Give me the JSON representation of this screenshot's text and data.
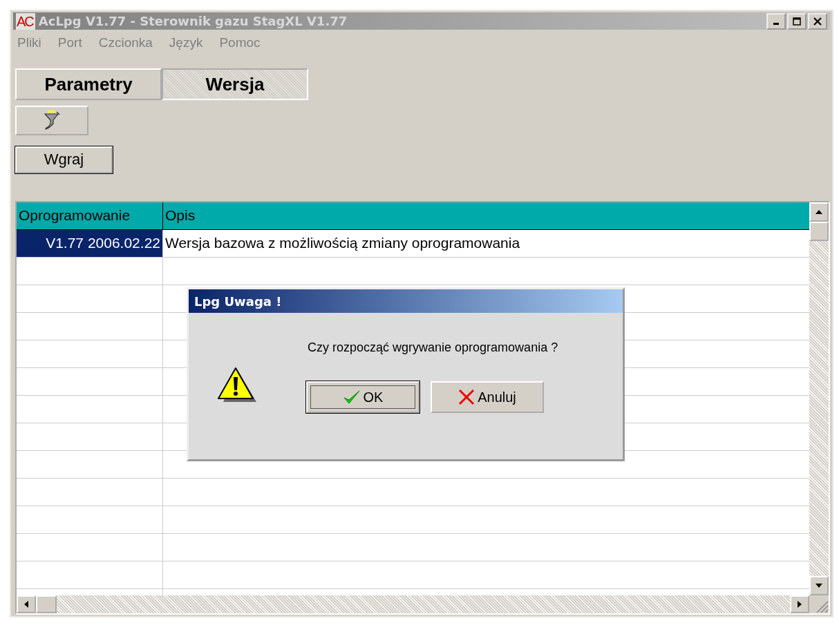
{
  "window": {
    "title": "AcLpg V1.77 - Sterownik gazu StagXL V1.77",
    "logo": "AC"
  },
  "menu": [
    "Pliki",
    "Port",
    "Czcionka",
    "Język",
    "Pomoc"
  ],
  "tabs": [
    {
      "label": "Parametry",
      "selected": false
    },
    {
      "label": "Wersja",
      "selected": true
    }
  ],
  "buttons": [
    {
      "kind": "icon"
    },
    {
      "kind": "text",
      "label": "Wgraj"
    }
  ],
  "table": {
    "columns": [
      "Oprogramowanie",
      "Opis"
    ],
    "rows": [
      {
        "cells": [
          "V1.77   2006.02.22",
          "Wersja bazowa z możliwością zmiany oprogramowania"
        ],
        "selected": true
      }
    ]
  },
  "dialog": {
    "title": "Lpg Uwaga !",
    "message": "Czy rozpocząć wgrywanie oprogramowania ?",
    "buttons": [
      {
        "label": "OK",
        "kind": "ok",
        "focused": true
      },
      {
        "label": "Anuluj",
        "kind": "cancel",
        "focused": false
      }
    ]
  }
}
